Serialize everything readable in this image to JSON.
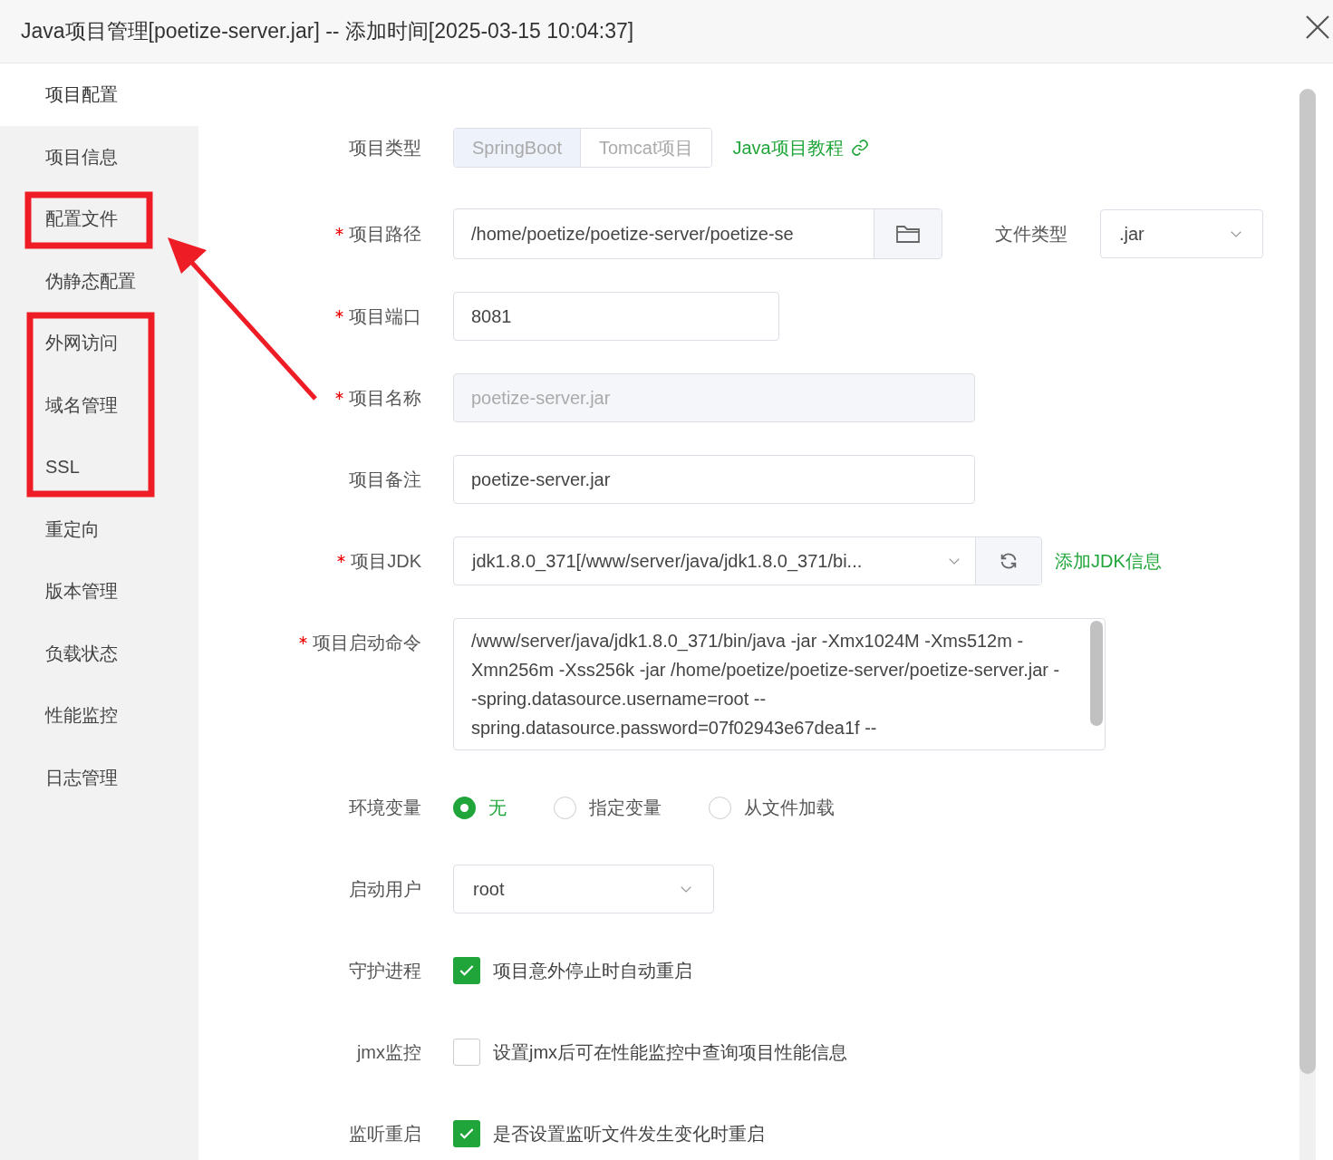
{
  "window": {
    "title": "Java项目管理[poetize-server.jar] -- 添加时间[2025-03-15 10:04:37]"
  },
  "sidebar": {
    "items": [
      {
        "label": "项目配置",
        "selected": true
      },
      {
        "label": "项目信息",
        "selected": false
      },
      {
        "label": "配置文件",
        "selected": false
      },
      {
        "label": "伪静态配置",
        "selected": false
      },
      {
        "label": "外网访问",
        "selected": false
      },
      {
        "label": "域名管理",
        "selected": false
      },
      {
        "label": "SSL",
        "selected": false
      },
      {
        "label": "重定向",
        "selected": false
      },
      {
        "label": "版本管理",
        "selected": false
      },
      {
        "label": "负载状态",
        "selected": false
      },
      {
        "label": "性能监控",
        "selected": false
      },
      {
        "label": "日志管理",
        "selected": false
      }
    ]
  },
  "form": {
    "rows": [
      {
        "kind": "segmented",
        "label": "项目类型",
        "required": false,
        "options": [
          {
            "label": "SpringBoot",
            "selected": true
          },
          {
            "label": "Tomcat项目",
            "selected": false
          }
        ],
        "link": "Java项目教程"
      },
      {
        "kind": "path",
        "label": "项目路径",
        "required": true,
        "value": "/home/poetize/poetize-server/poetize-se",
        "extra_label": "文件类型",
        "extra_value": ".jar"
      },
      {
        "kind": "input",
        "label": "项目端口",
        "required": true,
        "value": "8081",
        "disabled": false
      },
      {
        "kind": "input",
        "label": "项目名称",
        "required": true,
        "value": "poetize-server.jar",
        "disabled": true
      },
      {
        "kind": "input",
        "label": "项目备注",
        "required": false,
        "value": "poetize-server.jar",
        "disabled": false
      },
      {
        "kind": "jdk",
        "label": "项目JDK",
        "required": true,
        "value": "jdk1.8.0_371[/www/server/java/jdk1.8.0_371/bi...",
        "link": "添加JDK信息"
      },
      {
        "kind": "textarea",
        "label": "项目启动命令",
        "required": true,
        "value": "/www/server/java/jdk1.8.0_371/bin/java -jar -Xmx1024M -Xms512m -Xmn256m -Xss256k -jar /home/poetize/poetize-server/poetize-server.jar --spring.datasource.username=root --spring.datasource.password=07f02943e67dea1f --"
      },
      {
        "kind": "radio",
        "label": "环境变量",
        "required": false,
        "options": [
          {
            "label": "无",
            "selected": true
          },
          {
            "label": "指定变量",
            "selected": false
          },
          {
            "label": "从文件加载",
            "selected": false
          }
        ]
      },
      {
        "kind": "select",
        "label": "启动用户",
        "required": false,
        "value": "root"
      },
      {
        "kind": "checkbox",
        "label": "守护进程",
        "required": false,
        "checked": true,
        "text": "项目意外停止时自动重启"
      },
      {
        "kind": "checkbox",
        "label": "jmx监控",
        "required": false,
        "checked": false,
        "text": "设置jmx后可在性能监控中查询项目性能信息"
      },
      {
        "kind": "checkbox",
        "label": "监听重启",
        "required": false,
        "checked": true,
        "text": "是否设置监听文件发生变化时重启"
      }
    ]
  }
}
